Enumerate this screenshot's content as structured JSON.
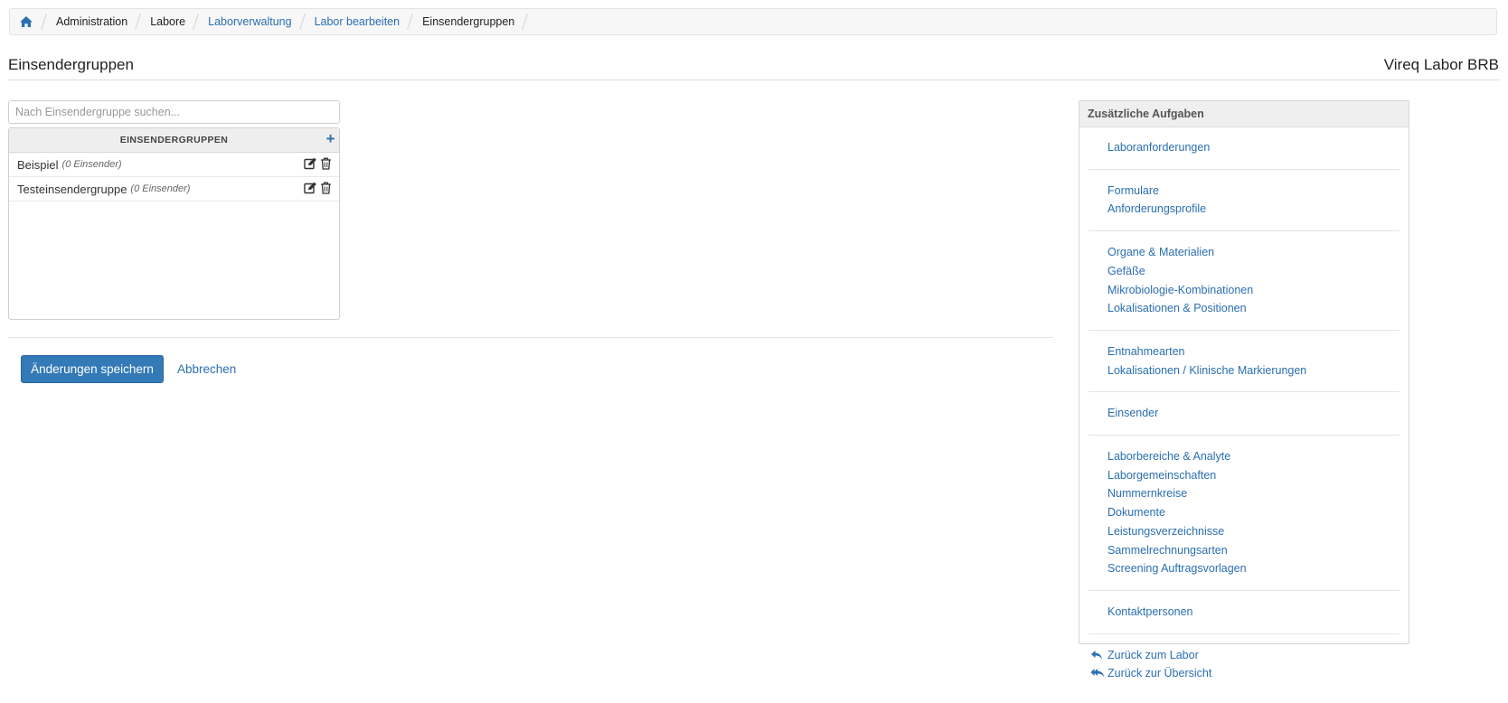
{
  "breadcrumb": {
    "items": [
      {
        "label": "Administration",
        "link": false
      },
      {
        "label": "Labore",
        "link": false
      },
      {
        "label": "Laborverwaltung",
        "link": true
      },
      {
        "label": "Labor bearbeiten",
        "link": true
      },
      {
        "label": "Einsendergruppen",
        "link": false
      }
    ]
  },
  "header": {
    "title": "Einsendergruppen",
    "lab_name": "Vireq Labor BRB"
  },
  "search": {
    "placeholder": "Nach Einsendergruppe suchen...",
    "value": ""
  },
  "groups": {
    "header": "EINSENDERGRUPPEN",
    "add_label": "+",
    "rows": [
      {
        "name": "Beispiel",
        "count": "(0 Einsender)"
      },
      {
        "name": "Testeinsendergruppe",
        "count": "(0 Einsender)"
      }
    ]
  },
  "form": {
    "save_label": "Änderungen speichern",
    "cancel_label": "Abbrechen"
  },
  "sidebar": {
    "title": "Zusätzliche Aufgaben",
    "groups": [
      [
        "Laboranforderungen"
      ],
      [
        "Formulare",
        "Anforderungsprofile"
      ],
      [
        "Organe & Materialien",
        "Gefäße",
        "Mikrobiologie-Kombinationen",
        "Lokalisationen & Positionen"
      ],
      [
        "Entnahmearten",
        "Lokalisationen / Klinische Markierungen"
      ],
      [
        "Einsender"
      ],
      [
        "Laborbereiche & Analyte",
        "Laborgemeinschaften",
        "Nummernkreise",
        "Dokumente",
        "Leistungsverzeichnisse",
        "Sammelrechnungsarten",
        "Screening Auftragsvorlagen"
      ],
      [
        "Kontaktpersonen"
      ]
    ],
    "back_links": [
      {
        "label": "Zurück zum Labor",
        "icon": "reply-icon"
      },
      {
        "label": "Zurück zur Übersicht",
        "icon": "reply-all-icon"
      }
    ]
  },
  "colors": {
    "link": "#2a6fb0",
    "primary_button": "#337ab7"
  }
}
